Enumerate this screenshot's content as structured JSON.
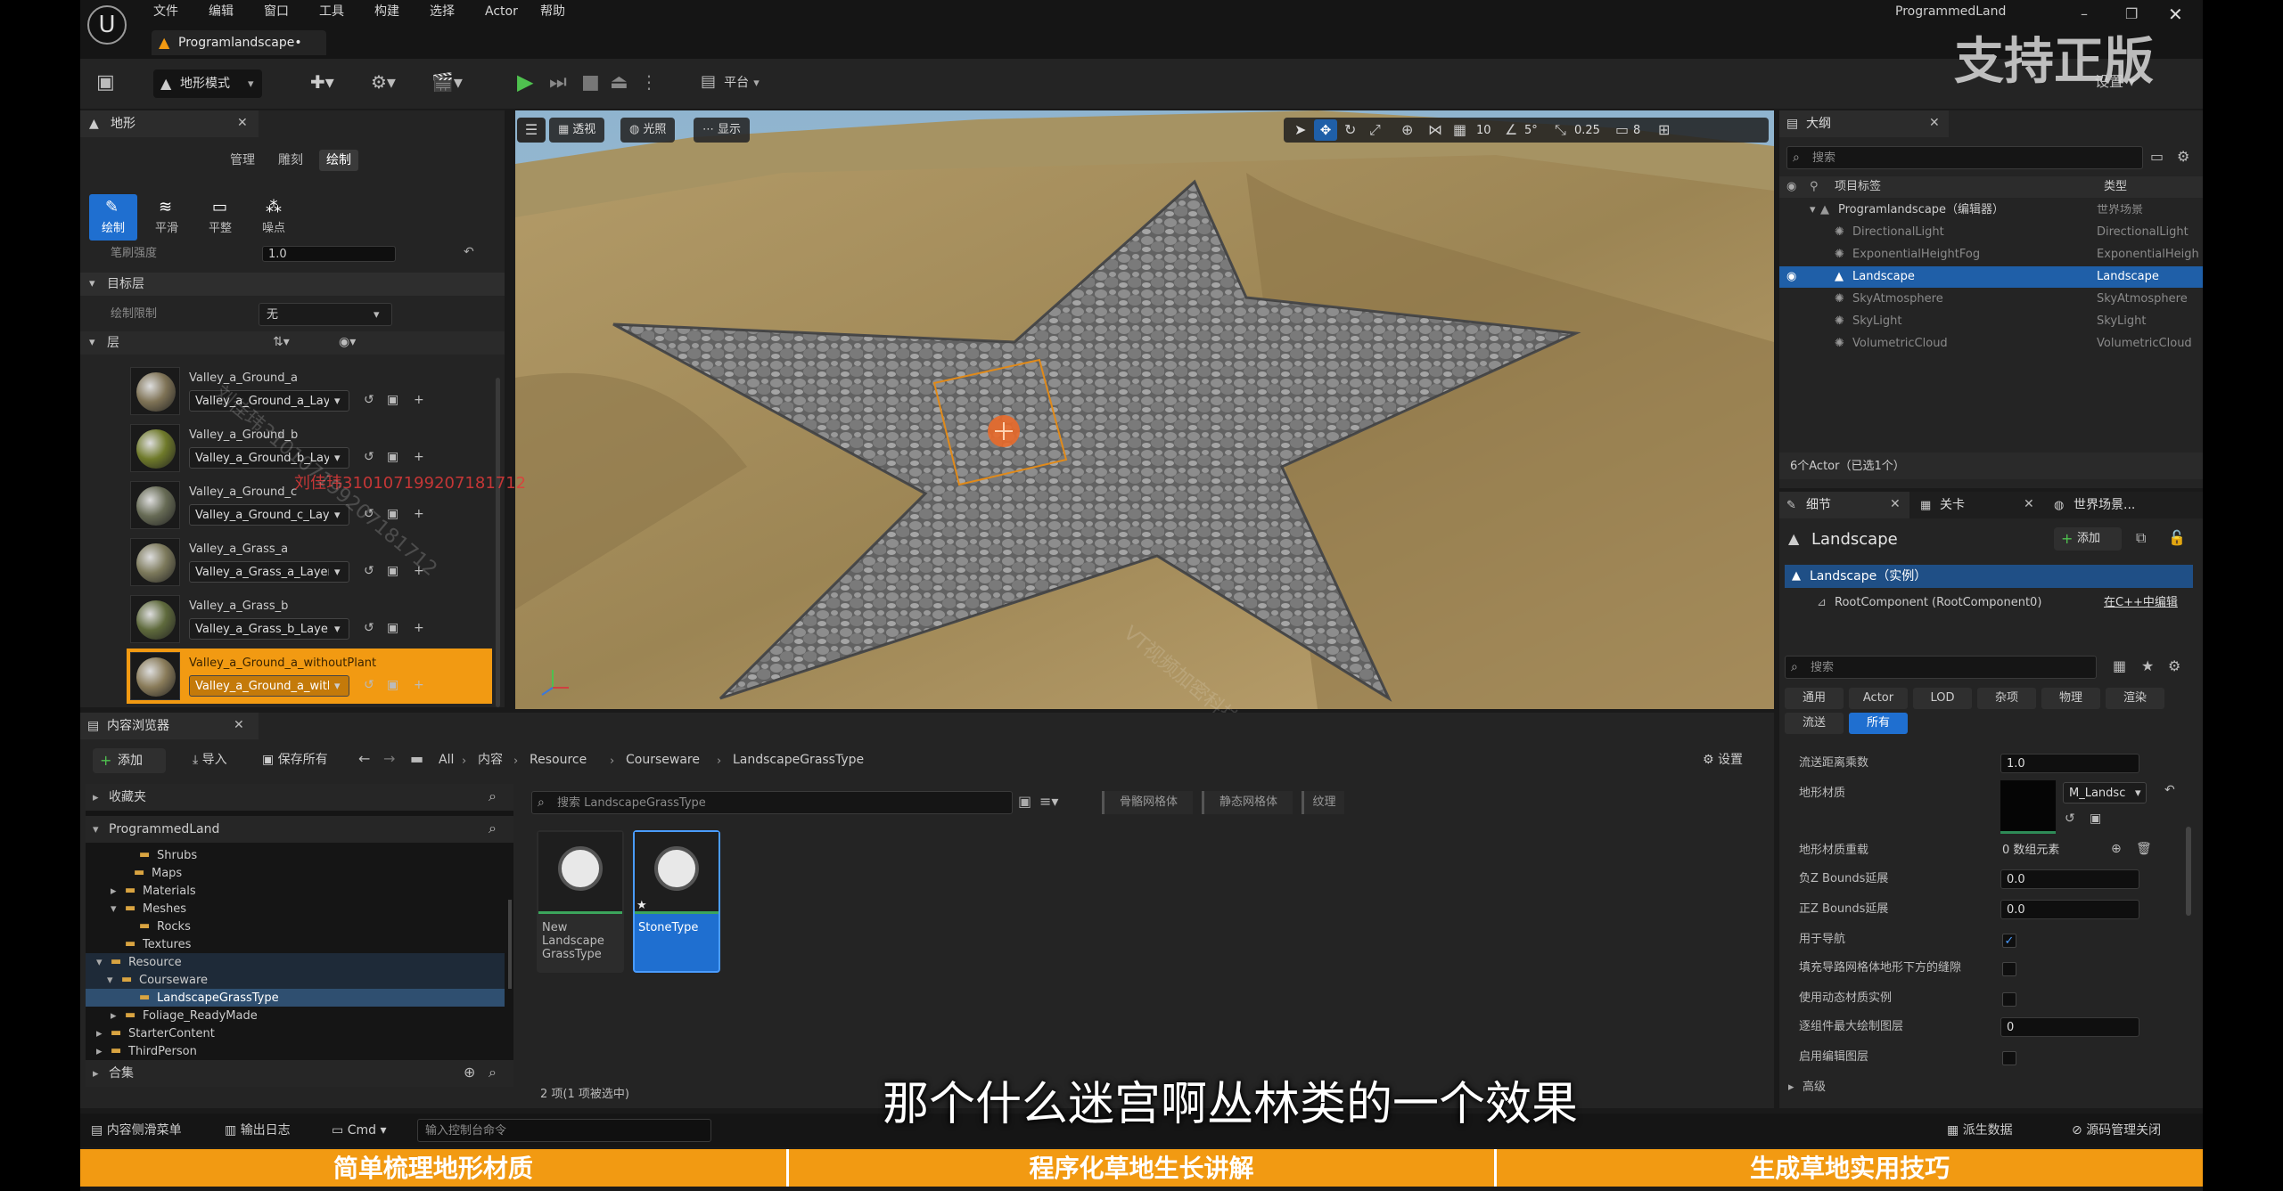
{
  "menu": {
    "logo": "Unreal logo",
    "items": [
      "文件",
      "编辑",
      "窗口",
      "工具",
      "构建",
      "选择",
      "Actor",
      "帮助"
    ],
    "project": "ProgrammedLand",
    "tab": "Programlandscape•"
  },
  "toolbar": {
    "mode": "地形模式",
    "platform": "平台"
  },
  "watermark": {
    "top": "支持正版",
    "name_code": "刘佳玮310107199207181712",
    "vt": "VT视频加密科技",
    "overlay_red": "刘佳玮310107199207181712"
  },
  "landscape_panel": {
    "title": "地形",
    "tabs": [
      "管理",
      "雕刻",
      "绘制"
    ],
    "tools": [
      "绘制",
      "平滑",
      "平整",
      "噪点"
    ],
    "strength_label": "笔刷强度",
    "strength_value": "1.0",
    "target_layer": "目标层",
    "paint_limit_label": "绘制限制",
    "paint_limit_value": "无",
    "layers_label": "层",
    "layers": [
      {
        "name": "Valley_a_Ground_a",
        "info": "Valley_a_Ground_a_Layer",
        "color": "#7f7356"
      },
      {
        "name": "Valley_a_Ground_b",
        "info": "Valley_a_Ground_b_Layer",
        "color": "#6f7a2a"
      },
      {
        "name": "Valley_a_Ground_c",
        "info": "Valley_a_Ground_c_Layer",
        "color": "#676b55"
      },
      {
        "name": "Valley_a_Grass_a",
        "info": "Valley_a_Grass_a_Layer",
        "color": "#7d7a5c"
      },
      {
        "name": "Valley_a_Grass_b",
        "info": "Valley_a_Grass_b_Layer",
        "color": "#5f6a3c"
      },
      {
        "name": "Valley_a_Ground_a_withoutPlant",
        "info": "Valley_a_Ground_a_with",
        "color": "#8a7c5a"
      }
    ]
  },
  "viewport": {
    "buttons": [
      "透视",
      "光照",
      "显示"
    ],
    "grid": "10",
    "angle": "5°",
    "scale": "0.25",
    "camera": "8"
  },
  "outliner": {
    "title": "大纲",
    "search": "搜索",
    "col_label": "项目标签",
    "col_type": "类型",
    "rows": [
      {
        "label": "Programlandscape（编辑器）",
        "type": "世界场景"
      },
      {
        "label": "DirectionalLight",
        "type": "DirectionalLight"
      },
      {
        "label": "ExponentialHeightFog",
        "type": "ExponentialHeightFog"
      },
      {
        "label": "Landscape",
        "type": "Landscape"
      },
      {
        "label": "SkyAtmosphere",
        "type": "SkyAtmosphere"
      },
      {
        "label": "SkyLight",
        "type": "SkyLight"
      },
      {
        "label": "VolumetricCloud",
        "type": "VolumetricCloud"
      }
    ],
    "count": "6个Actor（已选1个）"
  },
  "details": {
    "tabs": [
      "细节",
      "关卡",
      "世界场景..."
    ],
    "title": "Landscape",
    "add": "添加",
    "instance": "Landscape（实例）",
    "root": "RootComponent (RootComponent0)",
    "edit_cpp": "在C++中编辑",
    "search": "搜索",
    "filters": [
      "通用",
      "Actor",
      "LOD",
      "杂项",
      "物理",
      "渲染",
      "流送",
      "所有"
    ],
    "props": [
      {
        "label": "流送距离乘数",
        "value": "1.0"
      },
      {
        "label": "地形材质",
        "value": "M_Landsc"
      },
      {
        "label": "地形材质重载",
        "value": "0 数组元素"
      },
      {
        "label": "负Z Bounds延展",
        "value": "0.0"
      },
      {
        "label": "正Z Bounds延展",
        "value": "0.0"
      },
      {
        "label": "用于导航",
        "value": "✓"
      },
      {
        "label": "填充导路网格体地形下方的缝隙",
        "value": ""
      },
      {
        "label": "使用动态材质实例",
        "value": ""
      },
      {
        "label": "逐组件最大绘制图层",
        "value": "0"
      },
      {
        "label": "启用编辑图层",
        "value": ""
      },
      {
        "label": "高级",
        "value": ""
      }
    ]
  },
  "content_browser": {
    "title": "内容浏览器",
    "add": "添加",
    "import": "导入",
    "save_all": "保存所有",
    "breadcrumb": [
      "All",
      "内容",
      "Resource",
      "Courseware",
      "LandscapeGrassType"
    ],
    "settings": "设置",
    "favorites": "收藏夹",
    "root": "ProgrammedLand",
    "tree": [
      "Shrubs",
      "Maps",
      "Materials",
      "Meshes",
      "Rocks",
      "Textures",
      "Resource",
      "Courseware",
      "LandscapeGrassType",
      "Foliage_ReadyMade",
      "StarterContent",
      "ThirdPerson"
    ],
    "collections": "合集",
    "search": "搜索 LandscapeGrassType",
    "filters": [
      "骨骼网格体",
      "静态网格体",
      "纹理"
    ],
    "assets": [
      {
        "name": "New Landscape GrassType"
      },
      {
        "name": "StoneType"
      }
    ],
    "status": "2 项(1 项被选中)"
  },
  "statusbar": {
    "drawer": "内容侧滑菜单",
    "output": "输出日志",
    "cmd": "Cmd",
    "cmd_placeholder": "输入控制台命令",
    "derived": "派生数据",
    "source": "源码管理关闭"
  },
  "subtitle": "那个什么迷宫啊丛林类的一个效果",
  "banner": [
    "简单梳理地形材质",
    "程序化草地生长讲解",
    "生成草地实用技巧"
  ]
}
